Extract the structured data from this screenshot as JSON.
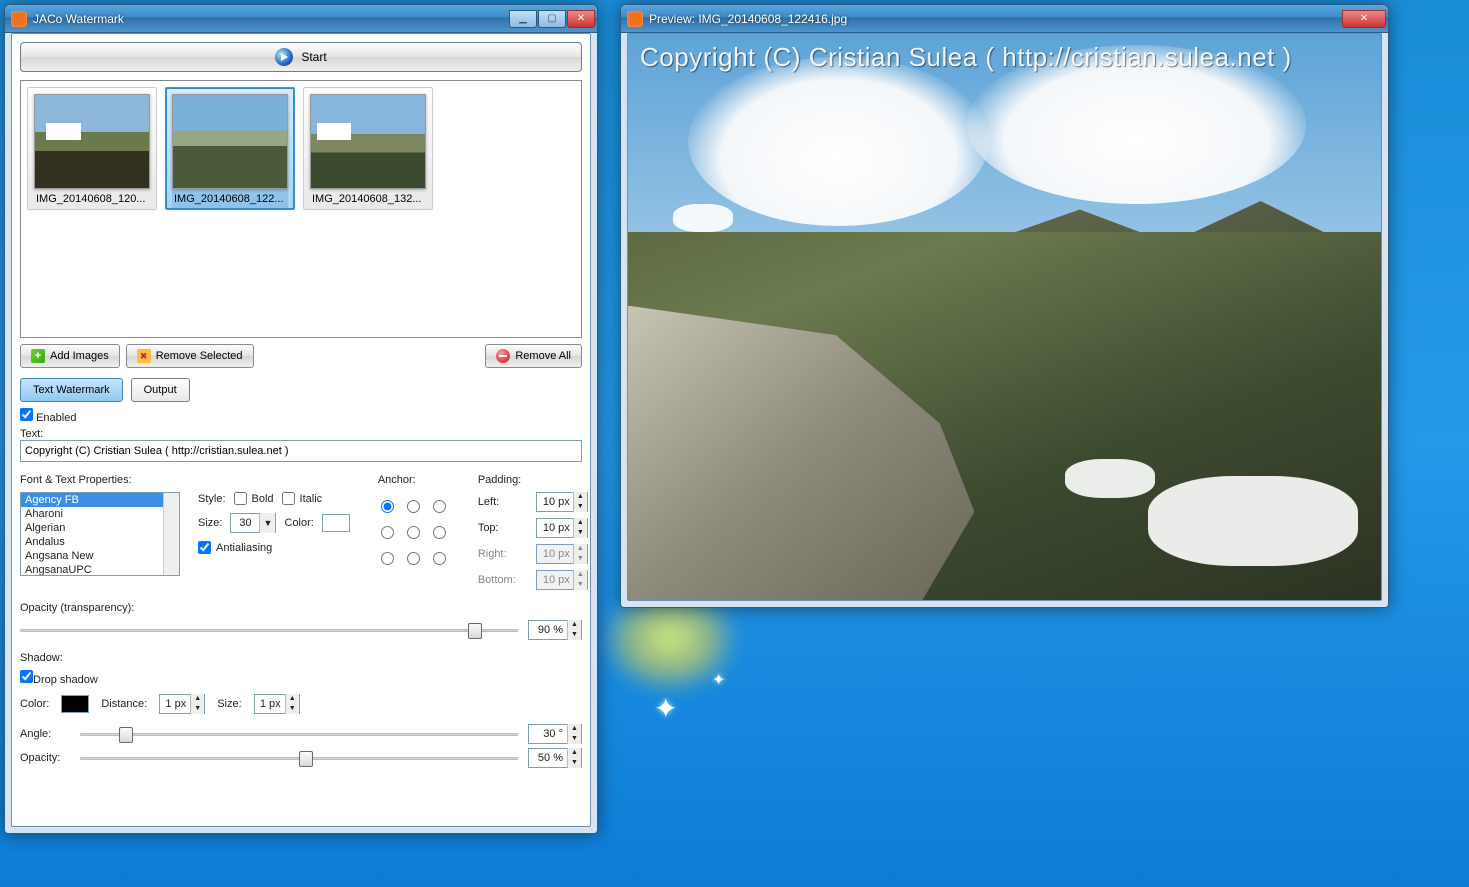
{
  "main": {
    "title": "JACo Watermark",
    "start_label": "Start",
    "thumbs": [
      {
        "caption": "IMG_20140608_120..."
      },
      {
        "caption": "IMG_20140608_122..."
      },
      {
        "caption": "IMG_20140608_132..."
      }
    ],
    "selected_thumb_index": 1,
    "buttons": {
      "add_images": "Add Images",
      "remove_selected": "Remove Selected",
      "remove_all": "Remove All"
    },
    "tabs": {
      "text_watermark": "Text Watermark",
      "output": "Output",
      "active": 0
    },
    "enabled_label": "Enabled",
    "enabled_checked": true,
    "text_label": "Text:",
    "text_value": "Copyright (C) Cristian Sulea ( http://cristian.sulea.net )",
    "font_props_label": "Font & Text Properties:",
    "fonts": [
      "Agency FB",
      "Aharoni",
      "Algerian",
      "Andalus",
      "Angsana New",
      "AngsanaUPC"
    ],
    "fonts_selected_index": 0,
    "style_label": "Style:",
    "bold_label": "Bold",
    "bold_checked": false,
    "italic_label": "Italic",
    "italic_checked": false,
    "size_label": "Size:",
    "size_value": "30",
    "color_label": "Color:",
    "antialias_label": "Antialiasing",
    "antialias_checked": true,
    "anchor_label": "Anchor:",
    "anchor_selected": 0,
    "padding_label": "Padding:",
    "padding": {
      "left_label": "Left:",
      "left_value": "10 px",
      "top_label": "Top:",
      "top_value": "10 px",
      "right_label": "Right:",
      "right_value": "10 px",
      "bottom_label": "Bottom:",
      "bottom_value": "10 px"
    },
    "opacity_label": "Opacity (transparency):",
    "opacity_value": "90 %",
    "opacity_slider_pct": 90,
    "shadow_label": "Shadow:",
    "drop_shadow_label": "Drop shadow",
    "drop_shadow_checked": true,
    "shadow_color_label": "Color:",
    "shadow_distance_label": "Distance:",
    "shadow_distance_value": "1 px",
    "shadow_size_label": "Size:",
    "shadow_size_value": "1 px",
    "shadow_angle_label": "Angle:",
    "shadow_angle_value": "30 °",
    "shadow_angle_slider_pct": 17,
    "shadow_opacity_label": "Opacity:",
    "shadow_opacity_value": "50 %",
    "shadow_opacity_slider_pct": 50
  },
  "preview": {
    "title": "Preview: IMG_20140608_122416.jpg",
    "watermark_text": "Copyright (C) Cristian Sulea ( http://cristian.sulea.net )"
  }
}
